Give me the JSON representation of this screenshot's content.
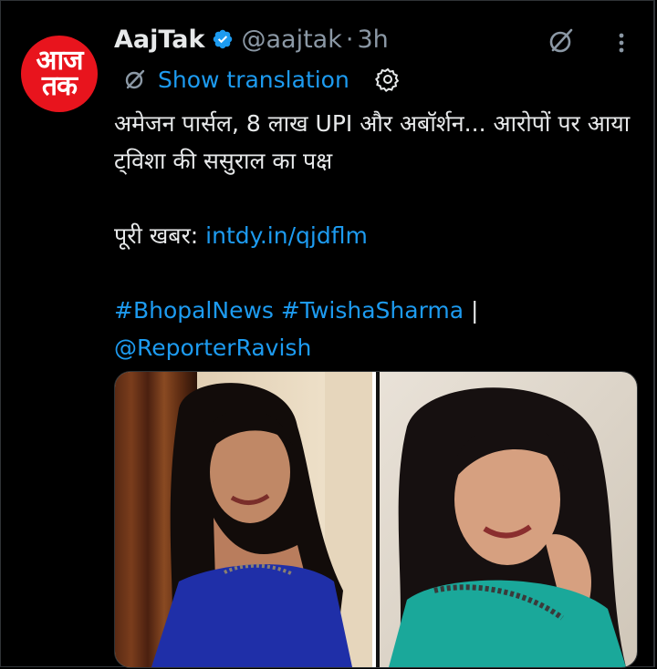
{
  "tweet": {
    "avatar_text": "आज\nतक",
    "display_name": "AajTak",
    "handle": "@aajtak",
    "separator": "·",
    "time": "3h",
    "show_translation": "Show translation",
    "text_line1": "अमेजन पार्सल, 8 लाख UPI और अबॉर्शन... आरोपों पर आया ट्विशा की ससुराल का पक्ष",
    "full_news_label": "पूरी खबर: ",
    "link": "intdy.in/qjdflm",
    "hashtag1": "#BhopalNews",
    "hashtag2": "#TwishaSharma",
    "pipe": " |",
    "mention": "@ReporterRavish"
  },
  "icons": {
    "verified": "verified-badge-icon",
    "grok": "grok-icon",
    "more": "more-options-icon",
    "translate": "translate-icon",
    "settings": "gear-icon"
  },
  "colors": {
    "background": "#000000",
    "text": "#e7e9ea",
    "secondary": "#8b98a5",
    "accent": "#1d9bf0",
    "brand_red": "#e8141d"
  }
}
